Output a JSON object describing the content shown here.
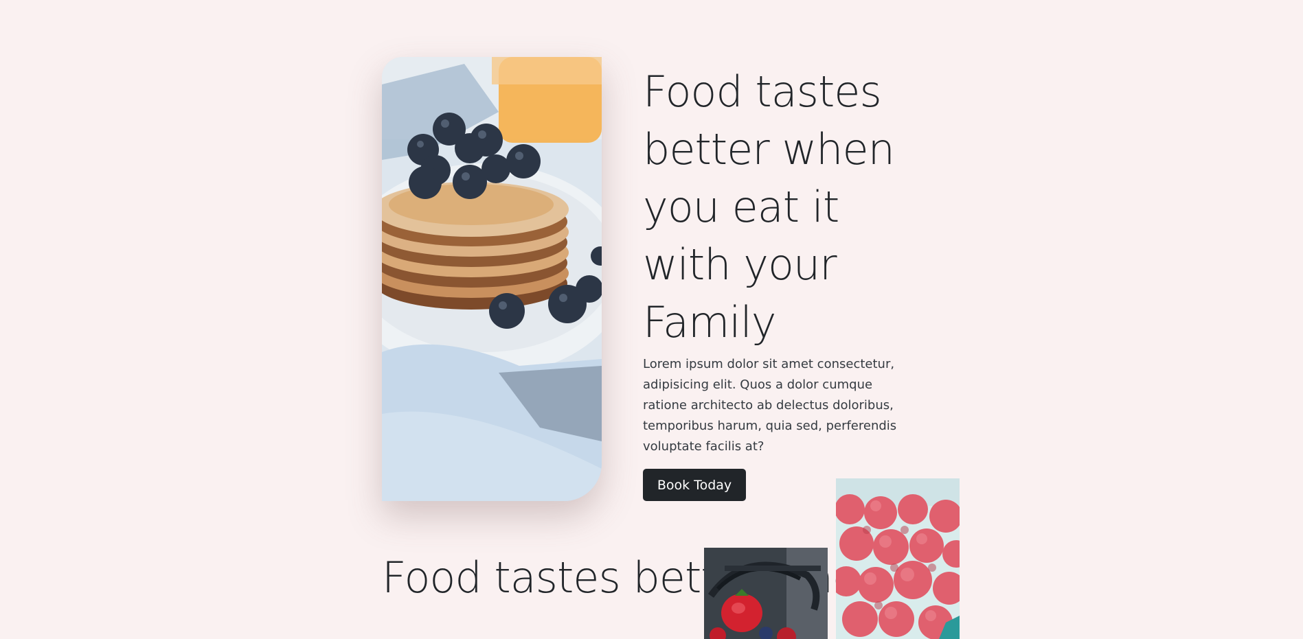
{
  "hero": {
    "title": "Food tastes better when you eat it with your Family",
    "text": "Lorem ipsum dolor sit amet consectetur, adipisicing elit. Quos a dolor cumque ratione architecto ab delectus doloribus, temporibus harum, quia sed, perferendis voluptate facilis at?",
    "button_label": "Book Today"
  },
  "second": {
    "title": "Food tastes better when"
  },
  "colors": {
    "background": "#faf1f1",
    "text": "#212529",
    "button": "#212529"
  }
}
